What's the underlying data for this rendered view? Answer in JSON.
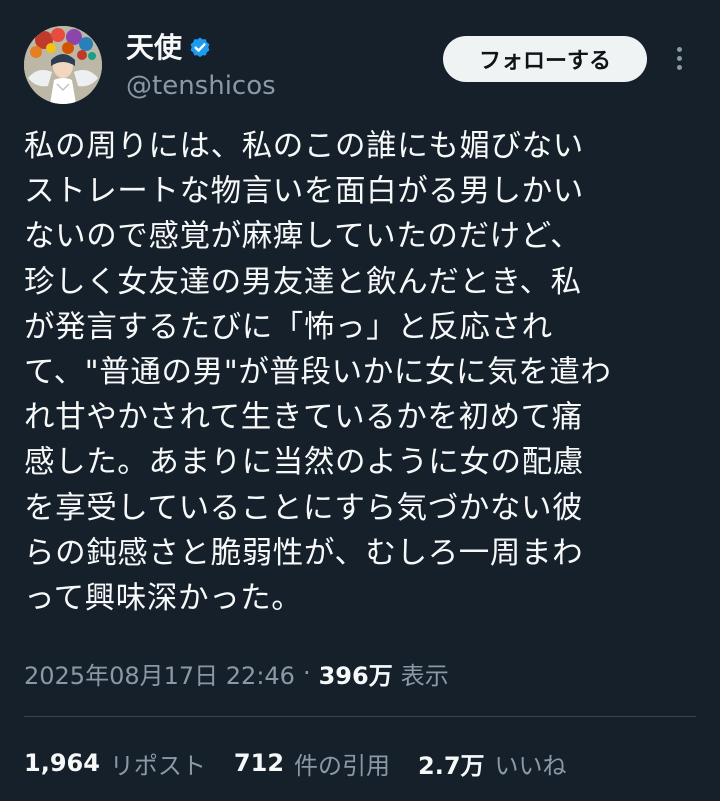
{
  "user": {
    "display_name": "天使",
    "handle": "@tenshicos",
    "avatar_icon": "avatar-angel-icon",
    "verified_icon": "verified-badge-icon",
    "verified_color": "#1d9bf0"
  },
  "actions": {
    "follow_label": "フォローする",
    "more_icon": "more-vertical-icon"
  },
  "tweet": {
    "lines": [
      "私の周りには、私のこの誰にも媚びない",
      "ストレートな物言いを面白がる男しかい",
      "ないので感覚が麻痺していたのだけど、",
      "珍しく女友達の男友達と飲んだとき、私",
      "が発言するたびに「怖っ」と反応され",
      "て、\"普通の男\"が普段いかに女に気を遣わ",
      "れ甘やかされて生きているかを初めて痛",
      "感した。あまりに当然のように女の配慮",
      "を享受していることにすら気づかない彼",
      "らの鈍感さと脆弱性が、むしろ一周まわ",
      "って興味深かった。"
    ]
  },
  "meta": {
    "timestamp": "2025年08月17日 22:46",
    "separator": "·",
    "views_count": "396万",
    "views_label": "表示"
  },
  "stats": {
    "reposts_count": "1,964",
    "reposts_label": "リポスト",
    "quotes_count": "712",
    "quotes_label": "件の引用",
    "likes_count": "2.7万",
    "likes_label": "いいね"
  },
  "colors": {
    "background": "#15202b",
    "text_primary": "#f7f9f9",
    "text_secondary": "#8b98a5",
    "divider": "#38444d",
    "follow_button_bg": "#eff3f4"
  }
}
